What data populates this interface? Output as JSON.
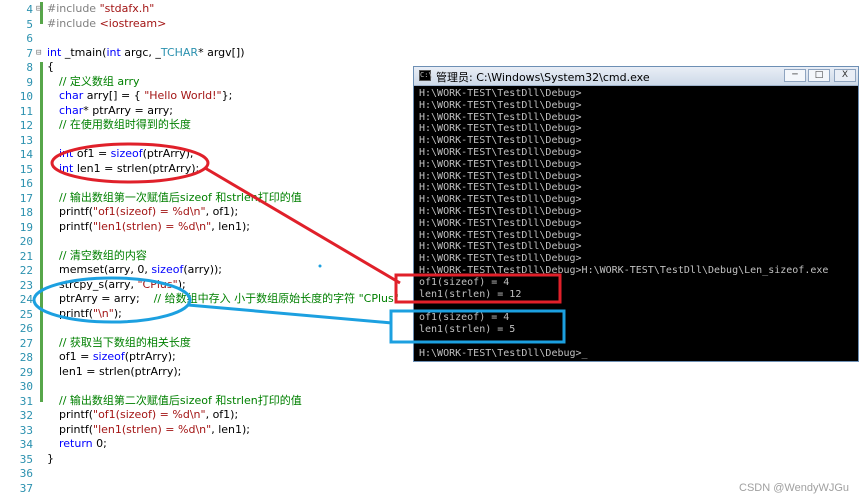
{
  "editor": {
    "line_numbers": [
      "4",
      "5",
      "6",
      "7",
      "8",
      "9",
      "10",
      "11",
      "12",
      "13",
      "14",
      "15",
      "16",
      "17",
      "18",
      "19",
      "20",
      "21",
      "22",
      "23",
      "24",
      "25",
      "26",
      "27",
      "28",
      "29",
      "30",
      "31",
      "32",
      "33",
      "34",
      "35",
      "36",
      "37"
    ],
    "lines": [
      {
        "n": "4",
        "indent": 0,
        "parts": [
          [
            "pp",
            "#include "
          ],
          [
            "str",
            "\"stdafx.h\""
          ]
        ]
      },
      {
        "n": "5",
        "indent": 0,
        "parts": [
          [
            "pp",
            "#include "
          ],
          [
            "str",
            "<iostream>"
          ]
        ]
      },
      {
        "n": "6",
        "indent": 0,
        "parts": []
      },
      {
        "n": "7",
        "indent": 0,
        "parts": [
          [
            "kw",
            "int"
          ],
          [
            "pl",
            " _tmain("
          ],
          [
            "kw",
            "int"
          ],
          [
            "pl",
            " argc, _"
          ],
          [
            "ty",
            "TCHAR"
          ],
          [
            "pl",
            "* argv[])"
          ]
        ]
      },
      {
        "n": "8",
        "indent": 0,
        "parts": [
          [
            "pl",
            "{"
          ]
        ]
      },
      {
        "n": "9",
        "indent": 1,
        "parts": [
          [
            "cm",
            "// 定义数组 arry"
          ]
        ]
      },
      {
        "n": "10",
        "indent": 1,
        "parts": [
          [
            "kw",
            "char"
          ],
          [
            "pl",
            " arry[] = { "
          ],
          [
            "str",
            "\"Hello World!\""
          ],
          [
            "pl",
            "};"
          ]
        ]
      },
      {
        "n": "11",
        "indent": 1,
        "parts": [
          [
            "kw",
            "char"
          ],
          [
            "pl",
            "* ptrArry = arry;"
          ]
        ]
      },
      {
        "n": "12",
        "indent": 1,
        "parts": [
          [
            "cm",
            "// 在使用数组时得到的长度"
          ]
        ]
      },
      {
        "n": "13",
        "indent": 1,
        "parts": []
      },
      {
        "n": "14",
        "indent": 1,
        "parts": [
          [
            "kw",
            "int"
          ],
          [
            "pl",
            " of1 = "
          ],
          [
            "kw",
            "sizeof"
          ],
          [
            "pl",
            "(ptrArry);"
          ]
        ]
      },
      {
        "n": "15",
        "indent": 1,
        "parts": [
          [
            "kw",
            "int"
          ],
          [
            "pl",
            " len1 = strlen(ptrArry);"
          ]
        ]
      },
      {
        "n": "16",
        "indent": 1,
        "parts": []
      },
      {
        "n": "17",
        "indent": 1,
        "parts": [
          [
            "cm",
            "// 输出数组第一次赋值后sizeof 和strlen打印的值"
          ]
        ]
      },
      {
        "n": "18",
        "indent": 1,
        "parts": [
          [
            "pl",
            "printf("
          ],
          [
            "str",
            "\"of1(sizeof) = %d\\n\""
          ],
          [
            "pl",
            ", of1);"
          ]
        ]
      },
      {
        "n": "19",
        "indent": 1,
        "parts": [
          [
            "pl",
            "printf("
          ],
          [
            "str",
            "\"len1(strlen) = %d\\n\""
          ],
          [
            "pl",
            ", len1);"
          ]
        ]
      },
      {
        "n": "20",
        "indent": 1,
        "parts": []
      },
      {
        "n": "21",
        "indent": 1,
        "parts": [
          [
            "cm",
            "// 清空数组的内容"
          ]
        ]
      },
      {
        "n": "22",
        "indent": 1,
        "parts": [
          [
            "pl",
            "memset(arry, 0, "
          ],
          [
            "kw",
            "sizeof"
          ],
          [
            "pl",
            "(arry));"
          ]
        ]
      },
      {
        "n": "23",
        "indent": 1,
        "parts": [
          [
            "pl",
            "strcpy_s(arry, "
          ],
          [
            "str",
            "\"CPlus\""
          ],
          [
            "pl",
            ");"
          ]
        ]
      },
      {
        "n": "24",
        "indent": 1,
        "parts": [
          [
            "pl",
            "ptrArry = arry;    "
          ],
          [
            "cm",
            "// 给数组中存入 小于数组原始长度的字符 \"CPlus\""
          ]
        ]
      },
      {
        "n": "25",
        "indent": 1,
        "parts": [
          [
            "pl",
            "printf("
          ],
          [
            "str",
            "\"\\n\""
          ],
          [
            "pl",
            ");"
          ]
        ]
      },
      {
        "n": "26",
        "indent": 1,
        "parts": []
      },
      {
        "n": "27",
        "indent": 1,
        "parts": [
          [
            "cm",
            "// 获取当下数组的相关长度"
          ]
        ]
      },
      {
        "n": "28",
        "indent": 1,
        "parts": [
          [
            "pl",
            "of1 = "
          ],
          [
            "kw",
            "sizeof"
          ],
          [
            "pl",
            "(ptrArry);"
          ]
        ]
      },
      {
        "n": "29",
        "indent": 1,
        "parts": [
          [
            "pl",
            "len1 = strlen(ptrArry);"
          ]
        ]
      },
      {
        "n": "30",
        "indent": 1,
        "parts": []
      },
      {
        "n": "31",
        "indent": 1,
        "parts": [
          [
            "cm",
            "// 输出数组第二次赋值后sizeof 和strlen打印的值"
          ]
        ]
      },
      {
        "n": "32",
        "indent": 1,
        "parts": [
          [
            "pl",
            "printf("
          ],
          [
            "str",
            "\"of1(sizeof) = %d\\n\""
          ],
          [
            "pl",
            ", of1);"
          ]
        ]
      },
      {
        "n": "33",
        "indent": 1,
        "parts": [
          [
            "pl",
            "printf("
          ],
          [
            "str",
            "\"len1(strlen) = %d\\n\""
          ],
          [
            "pl",
            ", len1);"
          ]
        ]
      },
      {
        "n": "34",
        "indent": 1,
        "parts": [
          [
            "kw",
            "return"
          ],
          [
            "pl",
            " 0;"
          ]
        ]
      },
      {
        "n": "35",
        "indent": 0,
        "parts": [
          [
            "pl",
            "}"
          ]
        ]
      },
      {
        "n": "36",
        "indent": 0,
        "parts": []
      },
      {
        "n": "37",
        "indent": 0,
        "parts": []
      }
    ]
  },
  "console": {
    "title": "管理员: C:\\Windows\\System32\\cmd.exe",
    "icon_label": "C:\\",
    "icon_name": "cmd-icon",
    "buttons": {
      "minimize": "─",
      "maximize": "□",
      "close": "X"
    },
    "lines": [
      "H:\\WORK-TEST\\TestDll\\Debug>",
      "H:\\WORK-TEST\\TestDll\\Debug>",
      "H:\\WORK-TEST\\TestDll\\Debug>",
      "H:\\WORK-TEST\\TestDll\\Debug>",
      "H:\\WORK-TEST\\TestDll\\Debug>",
      "H:\\WORK-TEST\\TestDll\\Debug>",
      "H:\\WORK-TEST\\TestDll\\Debug>",
      "H:\\WORK-TEST\\TestDll\\Debug>",
      "H:\\WORK-TEST\\TestDll\\Debug>",
      "H:\\WORK-TEST\\TestDll\\Debug>",
      "H:\\WORK-TEST\\TestDll\\Debug>",
      "H:\\WORK-TEST\\TestDll\\Debug>",
      "H:\\WORK-TEST\\TestDll\\Debug>",
      "H:\\WORK-TEST\\TestDll\\Debug>",
      "H:\\WORK-TEST\\TestDll\\Debug>",
      "H:\\WORK-TEST\\TestDll\\Debug>H:\\WORK-TEST\\TestDll\\Debug\\Len_sizeof.exe",
      "of1(sizeof) = 4",
      "len1(strlen) = 12",
      "",
      "of1(sizeof) = 4",
      "len1(strlen) = 5",
      "",
      "H:\\WORK-TEST\\TestDll\\Debug>_"
    ]
  },
  "annotations": {
    "red_color": "#e0202a",
    "blue_color": "#1ca0e0"
  },
  "watermark": "CSDN @WendyWJGu"
}
